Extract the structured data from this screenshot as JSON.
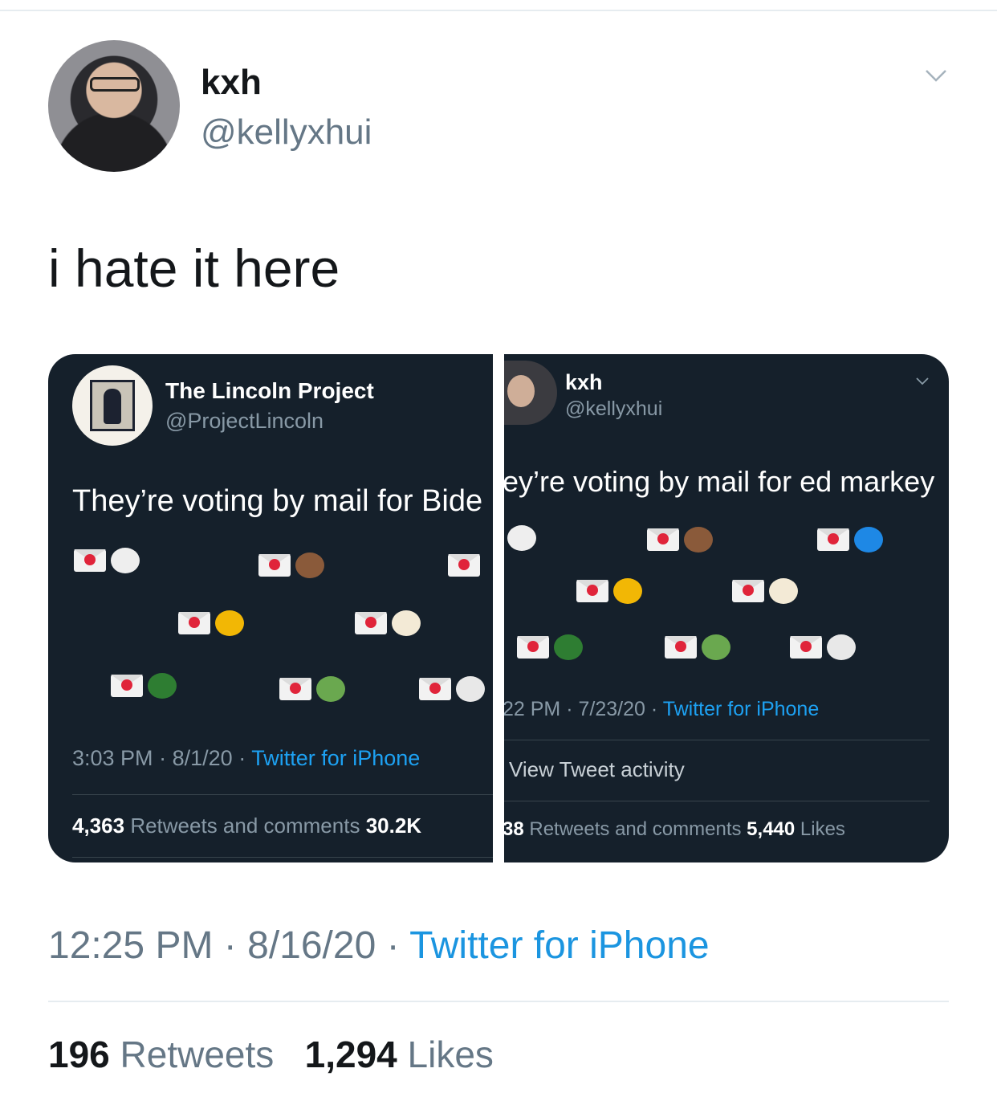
{
  "tweet": {
    "display_name": "kxh",
    "handle": "@kellyxhui",
    "text": "i hate it here",
    "time": "12:25 PM",
    "date": "8/16/20",
    "source": "Twitter for iPhone",
    "retweets_count": "196",
    "retweets_label": "Retweets",
    "likes_count": "1,294",
    "likes_label": "Likes",
    "separator": "·"
  },
  "left_panel": {
    "display_name": "The Lincoln Project",
    "handle": "@ProjectLincoln",
    "text": "They’re voting by mail for Bide",
    "time": "3:03 PM",
    "date": "8/1/20",
    "source": "Twitter for iPhone",
    "retweets_count": "4,363",
    "retweets_label": "Retweets and comments",
    "likes_count": "30.2K"
  },
  "right_panel": {
    "display_name": "kxh",
    "handle": "@kellyxhui",
    "text": "ey’re voting by mail for ed markey",
    "time": "22 PM",
    "date": "7/23/20",
    "source": "Twitter for iPhone",
    "activity": "View Tweet activity",
    "retweets_count": "38",
    "retweets_label": "Retweets and comments",
    "likes_count": "5,440",
    "likes_label": "Likes"
  },
  "emoji_icons": [
    "love-letter-icon",
    "sheep-icon",
    "otter-icon",
    "bee-icon",
    "llama-icon",
    "duck-icon",
    "turtle-icon",
    "dove-icon",
    "dinosaur-icon"
  ],
  "colors": {
    "panel_bg": "#15202b",
    "link_blue": "#1da1f2",
    "muted": "#657786",
    "heart_red": "#e0243a"
  }
}
